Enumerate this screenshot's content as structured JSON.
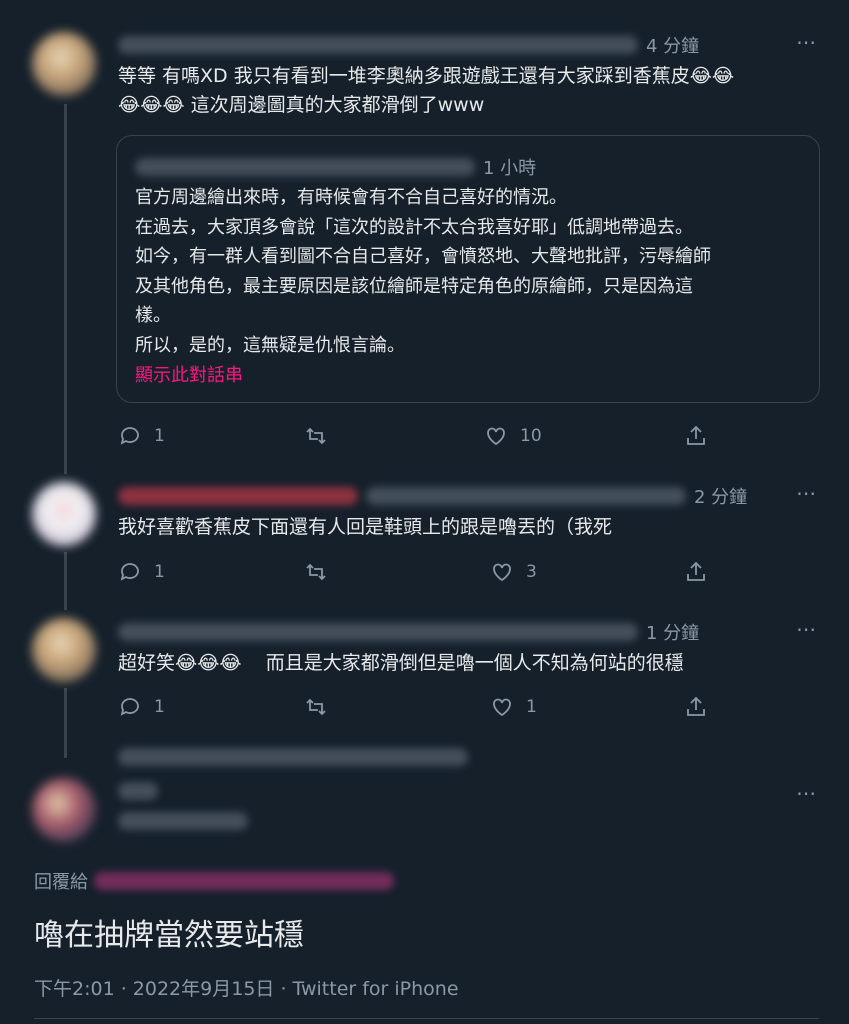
{
  "tweets": [
    {
      "time": "4 分鐘",
      "text_line1": "等等 有嗎XD 我只有看到一堆李奧納多跟遊戲王還有大家踩到香蕉皮😂😂",
      "text_line2": "😂😂😂 這次周邊圖真的大家都滑倒了www",
      "actions": {
        "reply": "1",
        "retweet": "",
        "like": "10"
      }
    },
    {
      "time": "2 分鐘",
      "text": "我好喜歡香蕉皮下面還有人回是鞋頭上的跟是嚕丟的（我死",
      "actions": {
        "reply": "1",
        "retweet": "",
        "like": "3"
      }
    },
    {
      "time": "1 分鐘",
      "text": "超好笑😂😂😂    而且是大家都滑倒但是嚕一個人不知為何站的很穩",
      "actions": {
        "reply": "1",
        "retweet": "",
        "like": "1"
      }
    }
  ],
  "quote": {
    "time": "1 小時",
    "body": "官方周邊繪出來時，有時候會有不合自己喜好的情況。\n在過去，大家頂多會說「這次的設計不太合我喜好耶」低調地帶過去。\n如今，有一群人看到圖不合自己喜好，會憤怒地、大聲地批評，污辱繪師\n及其他角色，最主要原因是該位繪師是特定角色的原繪師，只是因為這\n樣。\n所以，是的，這無疑是仇恨言論。",
    "show_thread": "顯示此對話串"
  },
  "main_tweet": {
    "reply_prefix": "回覆給",
    "text": "嚕在抽牌當然要站穩",
    "timestamp": "下午2:01 · 2022年9月15日 · Twitter for iPhone"
  },
  "icons": {
    "more": "⋯"
  },
  "colors": {
    "background": "#15202b",
    "muted": "#8b98a5",
    "link": "#f91880",
    "border": "#38444d"
  }
}
